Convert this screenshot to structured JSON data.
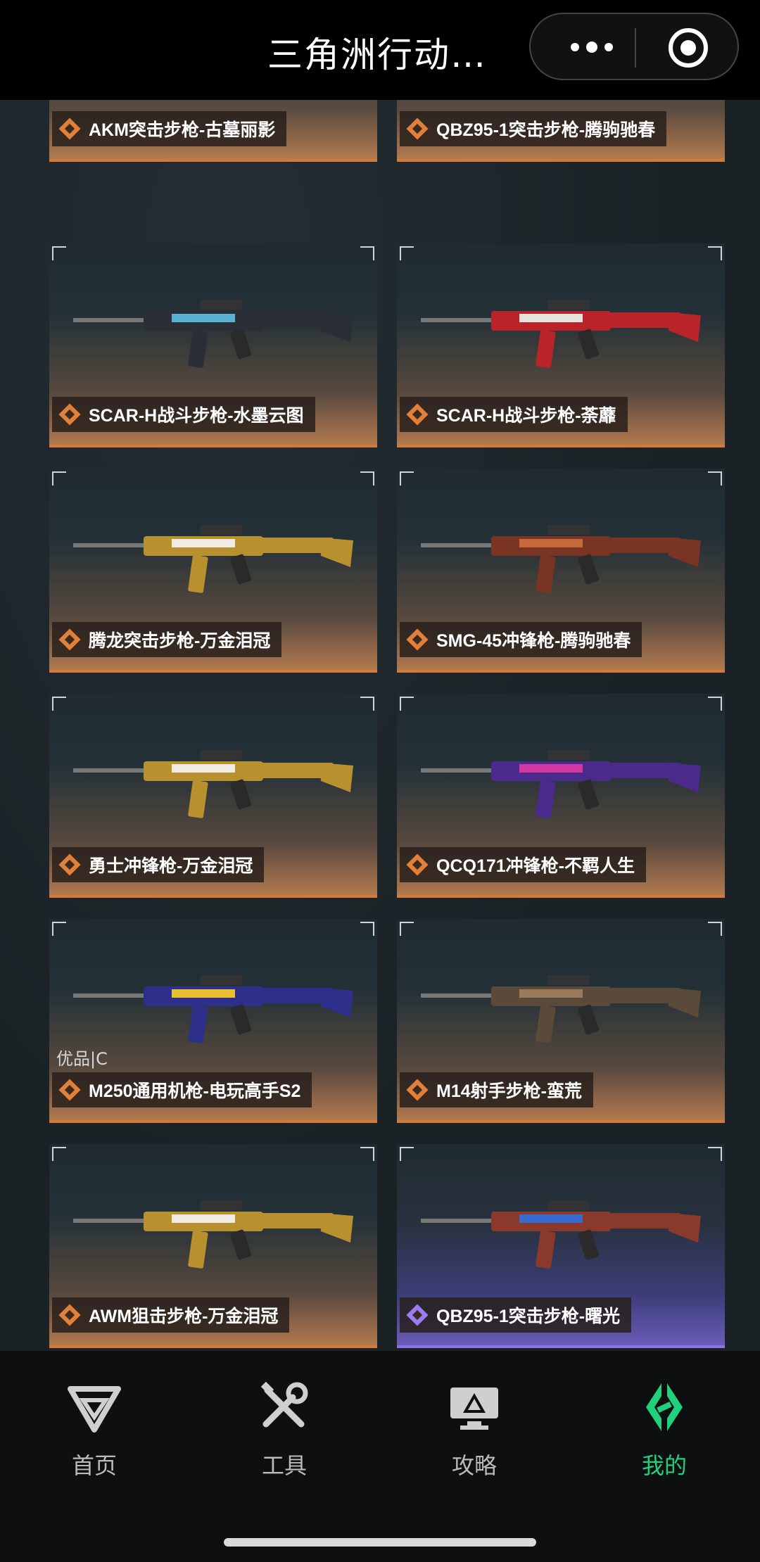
{
  "header": {
    "title": "三角洲行动…",
    "more_icon": "more-dots-icon",
    "close_icon": "target-close-icon"
  },
  "cards": [
    {
      "name": "AKM突击步枪-古墓丽影",
      "rarity": "orange",
      "weapon_colors": [
        "#7a3a22",
        "#c7b49a"
      ]
    },
    {
      "name": "QBZ95-1突击步枪-腾驹驰春",
      "rarity": "orange",
      "weapon_colors": [
        "#8a2a1a",
        "#d0703a"
      ]
    },
    {
      "name": "SCAR-H战斗步枪-水墨云图",
      "rarity": "orange",
      "weapon_colors": [
        "#2a2f36",
        "#5ab0d0"
      ]
    },
    {
      "name": "SCAR-H战斗步枪-荼蘼",
      "rarity": "orange",
      "weapon_colors": [
        "#b8242a",
        "#e8e2dc"
      ]
    },
    {
      "name": "腾龙突击步枪-万金泪冠",
      "rarity": "orange",
      "weapon_colors": [
        "#b8912e",
        "#f0ece4"
      ]
    },
    {
      "name": "SMG-45冲锋枪-腾驹驰春",
      "rarity": "orange",
      "weapon_colors": [
        "#7a3424",
        "#c46a3a"
      ]
    },
    {
      "name": "勇士冲锋枪-万金泪冠",
      "rarity": "orange",
      "weapon_colors": [
        "#b8912e",
        "#f0ece4"
      ]
    },
    {
      "name": "QCQ171冲锋枪-不羁人生",
      "rarity": "orange",
      "weapon_colors": [
        "#4a2a8a",
        "#d03aa0"
      ]
    },
    {
      "name": "M250通用机枪-电玩高手S2",
      "rarity": "orange",
      "quality": "优品|C",
      "weapon_colors": [
        "#2e2f8a",
        "#e8c030"
      ]
    },
    {
      "name": "M14射手步枪-蛮荒",
      "rarity": "orange",
      "weapon_colors": [
        "#5a4a3a",
        "#9a7a5a"
      ]
    },
    {
      "name": "AWM狙击步枪-万金泪冠",
      "rarity": "orange",
      "weapon_colors": [
        "#b8912e",
        "#f0ece4"
      ]
    },
    {
      "name": "QBZ95-1突击步枪-曙光",
      "rarity": "purple",
      "weapon_colors": [
        "#8a3a2a",
        "#3a6ad0"
      ]
    }
  ],
  "nav": [
    {
      "label": "首页",
      "icon": "home-logo-icon",
      "active": false
    },
    {
      "label": "工具",
      "icon": "tools-icon",
      "active": false
    },
    {
      "label": "攻略",
      "icon": "guide-monitor-icon",
      "active": false
    },
    {
      "label": "我的",
      "icon": "profile-logo-icon",
      "active": true
    }
  ]
}
